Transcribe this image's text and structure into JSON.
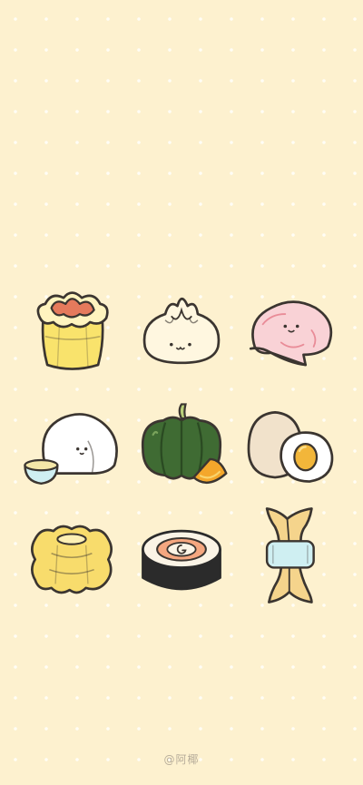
{
  "background": {
    "color": "#fdf1cf",
    "dot_color": "#fffdf6",
    "pattern": "polka-dot"
  },
  "illustrations": [
    {
      "name": "shumai",
      "colors": [
        "#f9e36c",
        "#e57a5c"
      ]
    },
    {
      "name": "steamed-bun",
      "colors": [
        "#fff7e0"
      ]
    },
    {
      "name": "pink-bun",
      "colors": [
        "#f9d2d6"
      ]
    },
    {
      "name": "rice-noodle-roll",
      "colors": [
        "#ffffff",
        "#f4e7a8"
      ]
    },
    {
      "name": "pumpkin",
      "colors": [
        "#3f6b33",
        "#f4a72b"
      ]
    },
    {
      "name": "eggs",
      "colors": [
        "#f1e2cb",
        "#f2b63a"
      ]
    },
    {
      "name": "corn-cake",
      "colors": [
        "#f8dc6c"
      ]
    },
    {
      "name": "sushi-roll",
      "colors": [
        "#2b2b2b",
        "#f5a780"
      ]
    },
    {
      "name": "fried-dough",
      "colors": [
        "#f5d48c",
        "#cfeff2"
      ]
    }
  ],
  "credit": {
    "text": "@阿椰"
  }
}
